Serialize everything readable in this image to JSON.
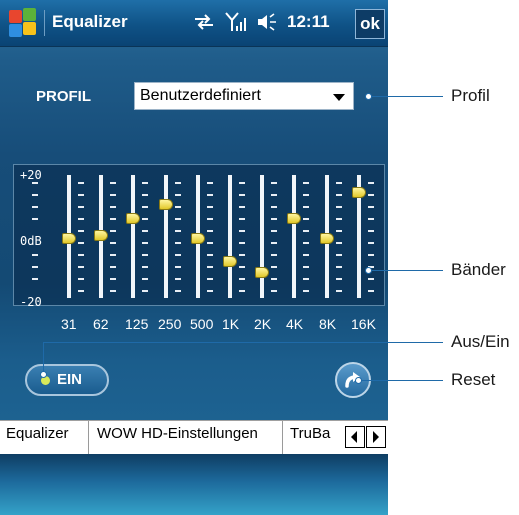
{
  "titlebar": {
    "app_title": "Equalizer",
    "time": "12:11",
    "ok_label": "ok"
  },
  "profile": {
    "label": "PROFIL",
    "selected": "Benutzerdefiniert"
  },
  "equalizer": {
    "y_labels": [
      "+20",
      "0dB",
      "-20"
    ],
    "bands": [
      {
        "label": "31",
        "gain": 0
      },
      {
        "label": "62",
        "gain": 1
      },
      {
        "label": "125",
        "gain": 7
      },
      {
        "label": "250",
        "gain": 12
      },
      {
        "label": "500",
        "gain": 0
      },
      {
        "label": "1K",
        "gain": -8
      },
      {
        "label": "2K",
        "gain": -12
      },
      {
        "label": "4K",
        "gain": 7
      },
      {
        "label": "8K",
        "gain": 0
      },
      {
        "label": "16K",
        "gain": 16
      }
    ]
  },
  "controls": {
    "toggle_label": "EIN"
  },
  "tabs": [
    {
      "label": "Equalizer"
    },
    {
      "label": "WOW HD-Einstellungen"
    },
    {
      "label": "TruBa"
    }
  ],
  "callouts": {
    "profil": "Profil",
    "baender": "Bänder",
    "aus_ein": "Aus/Ein",
    "reset": "Reset"
  },
  "icons": {
    "windows_logo": "windows-logo-icon",
    "connectivity": "sync-arrows-icon",
    "signal": "signal-strength-icon",
    "volume": "speaker-icon",
    "reset": "reset-arrow-icon"
  }
}
